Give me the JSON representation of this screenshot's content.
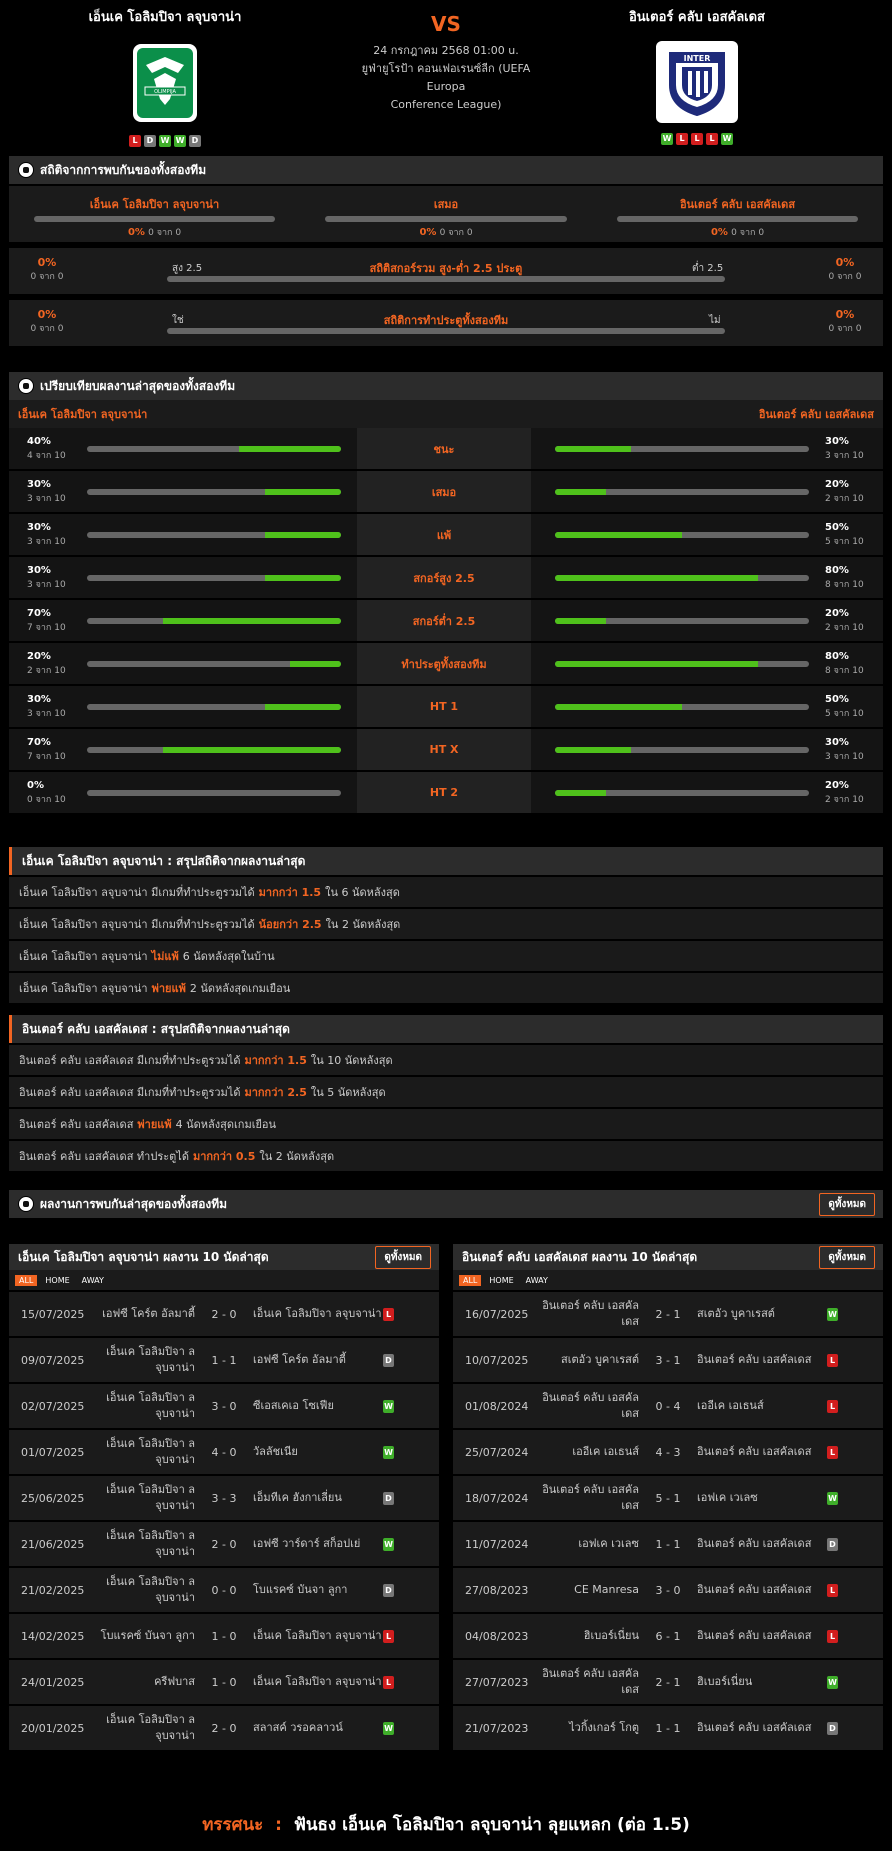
{
  "header": {
    "home_name": "เอ็นเค โอลิมปิจา ลจุบจาน่า",
    "away_name": "อินเตอร์ คลับ เอสคัลเดส",
    "vs": "VS",
    "date": "24 กรกฎาคม 2568 01:00 u.",
    "league_line1": "ยูฟ่ายูโรป้า คอนเฟอเรนซ์ลีก (UEFA Europa",
    "league_line2": "Conference League)",
    "home_form": [
      "L",
      "D",
      "W",
      "W",
      "D"
    ],
    "away_form": [
      "W",
      "L",
      "L",
      "L",
      "W"
    ],
    "home_logo_text": "OLIMPIJA",
    "away_logo_text": "INTER"
  },
  "h2h": {
    "title": "สถิติจากการพบกันของทั้งสองทีม",
    "home_label": "เอ็นเค โอลิมปิจา ลจุบจาน่า",
    "draw_label": "เสมอ",
    "away_label": "อินเตอร์ คลับ เอสคัลเดส",
    "home_pct": "0%",
    "home_of": "0 จาก 0",
    "draw_pct": "0%",
    "draw_of": "0 จาก 0",
    "away_pct": "0%",
    "away_of": "0 จาก 0",
    "ou_title": "สถิติสกอร์รวม สูง-ต่ำ 2.5 ประตู",
    "ou_left": "สูง 2.5",
    "ou_right": "ต่ำ 2.5",
    "ou_lpct": "0%",
    "ou_lof": "0 จาก 0",
    "ou_rpct": "0%",
    "ou_rof": "0 จาก 0",
    "btts_title": "สถิติการทำประตูทั้งสองทีม",
    "btts_left": "ใช่",
    "btts_right": "ไม่",
    "btts_lpct": "0%",
    "btts_lof": "0 จาก 0",
    "btts_rpct": "0%",
    "btts_rof": "0 จาก 0"
  },
  "compare": {
    "title": "เปรียบเทียบผลงานล่าสุดของทั้งสองทีม",
    "home": "เอ็นเค โอลิมปิจา ลจุบจาน่า",
    "away": "อินเตอร์ คลับ เอสคัลเดส",
    "rows": [
      {
        "label": "ชนะ",
        "hp": "40%",
        "ho": "4 จาก 10",
        "hv": 0.4,
        "ap": "30%",
        "ao": "3 จาก 10",
        "av": 0.3
      },
      {
        "label": "เสมอ",
        "hp": "30%",
        "ho": "3 จาก 10",
        "hv": 0.3,
        "ap": "20%",
        "ao": "2 จาก 10",
        "av": 0.2
      },
      {
        "label": "แพ้",
        "hp": "30%",
        "ho": "3 จาก 10",
        "hv": 0.3,
        "ap": "50%",
        "ao": "5 จาก 10",
        "av": 0.5
      },
      {
        "label": "สกอร์สูง 2.5",
        "hp": "30%",
        "ho": "3 จาก 10",
        "hv": 0.3,
        "ap": "80%",
        "ao": "8 จาก 10",
        "av": 0.8
      },
      {
        "label": "สกอร์ต่ำ 2.5",
        "hp": "70%",
        "ho": "7 จาก 10",
        "hv": 0.7,
        "ap": "20%",
        "ao": "2 จาก 10",
        "av": 0.2
      },
      {
        "label": "ทำประตูทั้งสองทีม",
        "hp": "20%",
        "ho": "2 จาก 10",
        "hv": 0.2,
        "ap": "80%",
        "ao": "8 จาก 10",
        "av": 0.8
      },
      {
        "label": "HT 1",
        "hp": "30%",
        "ho": "3 จาก 10",
        "hv": 0.3,
        "ap": "50%",
        "ao": "5 จาก 10",
        "av": 0.5
      },
      {
        "label": "HT X",
        "hp": "70%",
        "ho": "7 จาก 10",
        "hv": 0.7,
        "ap": "30%",
        "ao": "3 จาก 10",
        "av": 0.3
      },
      {
        "label": "HT 2",
        "hp": "0%",
        "ho": "0 จาก 10",
        "hv": 0.0,
        "ap": "20%",
        "ao": "2 จาก 10",
        "av": 0.2
      }
    ]
  },
  "home_summary": {
    "title": "เอ็นเค โอลิมปิจา ลจุบจาน่า : สรุปสถิติจากผลงานล่าสุด",
    "lines": [
      {
        "a": "เอ็นเค โอลิมปิจา ลจุบจาน่า มีเกมที่ทำประตูรวมได้",
        "b": "มากกว่า 1.5",
        "c": "ใน 6 นัดหลังสุด"
      },
      {
        "a": "เอ็นเค โอลิมปิจา ลจุบจาน่า มีเกมที่ทำประตูรวมได้",
        "b": "น้อยกว่า 2.5",
        "c": "ใน 2 นัดหลังสุด"
      },
      {
        "a": "เอ็นเค โอลิมปิจา ลจุบจาน่า",
        "b": "ไม่แพ้",
        "c": "6 นัดหลังสุดในบ้าน"
      },
      {
        "a": "เอ็นเค โอลิมปิจา ลจุบจาน่า",
        "b": "พ่ายแพ้",
        "c": "2 นัดหลังสุดเกมเยือน"
      }
    ]
  },
  "away_summary": {
    "title": "อินเตอร์ คลับ เอสคัลเดส : สรุปสถิติจากผลงานล่าสุด",
    "lines": [
      {
        "a": "อินเตอร์ คลับ เอสคัลเดส มีเกมที่ทำประตูรวมได้",
        "b": "มากกว่า 1.5",
        "c": "ใน 10 นัดหลังสุด"
      },
      {
        "a": "อินเตอร์ คลับ เอสคัลเดส มีเกมที่ทำประตูรวมได้",
        "b": "มากกว่า 2.5",
        "c": "ใน 5 นัดหลังสุด"
      },
      {
        "a": "อินเตอร์ คลับ เอสคัลเดส",
        "b": "พ่ายแพ้",
        "c": "4 นัดหลังสุดเกมเยือน"
      },
      {
        "a": "อินเตอร์ คลับ เอสคัลเดส ทำประตูได้",
        "b": "มากกว่า 0.5",
        "c": "ใน 2 นัดหลังสุด"
      }
    ]
  },
  "recent": {
    "title": "ผลงานการพบกันล่าสุดของทั้งสองทีม",
    "view_all": "ดูทั้งหมด"
  },
  "home_last": {
    "title": "เอ็นเค โอลิมปิจา ลจุบจาน่า ผลงาน 10 นัดล่าสุด",
    "view_all": "ดูทั้งหมด",
    "tabs": [
      "ALL",
      "HOME",
      "AWAY"
    ],
    "matches": [
      {
        "d": "15/07/2025",
        "h": "เอฟซี โคร์ต อัลมาตี้",
        "s": "2 - 0",
        "a": "เอ็นเค โอลิมปิจา ลจุบจาน่า",
        "r": "L"
      },
      {
        "d": "09/07/2025",
        "h": "เอ็นเค โอลิมปิจา ลจุบจาน่า",
        "s": "1 - 1",
        "a": "เอฟซี โคร์ต อัลมาตี้",
        "r": "D"
      },
      {
        "d": "02/07/2025",
        "h": "เอ็นเค โอลิมปิจา ลจุบจาน่า",
        "s": "3 - 0",
        "a": "ซีเอสเคเอ โซเฟีย",
        "r": "W"
      },
      {
        "d": "01/07/2025",
        "h": "เอ็นเค โอลิมปิจา ลจุบจาน่า",
        "s": "4 - 0",
        "a": "วัลลัชเนีย",
        "r": "W"
      },
      {
        "d": "25/06/2025",
        "h": "เอ็นเค โอลิมปิจา ลจุบจาน่า",
        "s": "3 - 3",
        "a": "เอ็มทีเค ฮังกาเลี่ยน",
        "r": "D"
      },
      {
        "d": "21/06/2025",
        "h": "เอ็นเค โอลิมปิจา ลจุบจาน่า",
        "s": "2 - 0",
        "a": "เอฟซี วาร์ดาร์ สก็อปเย่",
        "r": "W"
      },
      {
        "d": "21/02/2025",
        "h": "เอ็นเค โอลิมปิจา ลจุบจาน่า",
        "s": "0 - 0",
        "a": "โบแรคซ์ บันจา ลูกา",
        "r": "D"
      },
      {
        "d": "14/02/2025",
        "h": "โบแรคซ์ บันจา ลูกา",
        "s": "1 - 0",
        "a": "เอ็นเค โอลิมปิจา ลจุบจาน่า",
        "r": "L"
      },
      {
        "d": "24/01/2025",
        "h": "ครีฟบาส",
        "s": "1 - 0",
        "a": "เอ็นเค โอลิมปิจา ลจุบจาน่า",
        "r": "L"
      },
      {
        "d": "20/01/2025",
        "h": "เอ็นเค โอลิมปิจา ลจุบจาน่า",
        "s": "2 - 0",
        "a": "สลาสค์ วรอคลาวน์",
        "r": "W"
      }
    ]
  },
  "away_last": {
    "title": "อินเตอร์ คลับ เอสคัลเดส ผลงาน 10 นัดล่าสุด",
    "view_all": "ดูทั้งหมด",
    "tabs": [
      "ALL",
      "HOME",
      "AWAY"
    ],
    "matches": [
      {
        "d": "16/07/2025",
        "h": "อินเตอร์ คลับ เอสคัลเดส",
        "s": "2 - 1",
        "a": "สเตอัว บูคาเรสต์",
        "r": "W"
      },
      {
        "d": "10/07/2025",
        "h": "สเตอัว บูคาเรสต์",
        "s": "3 - 1",
        "a": "อินเตอร์ คลับ เอสคัลเดส",
        "r": "L"
      },
      {
        "d": "01/08/2024",
        "h": "อินเตอร์ คลับ เอสคัลเดส",
        "s": "0 - 4",
        "a": "เออีเค เอเธนส์",
        "r": "L"
      },
      {
        "d": "25/07/2024",
        "h": "เออีเค เอเธนส์",
        "s": "4 - 3",
        "a": "อินเตอร์ คลับ เอสคัลเดส",
        "r": "L"
      },
      {
        "d": "18/07/2024",
        "h": "อินเตอร์ คลับ เอสคัลเดส",
        "s": "5 - 1",
        "a": "เอฟเค เวเลซ",
        "r": "W"
      },
      {
        "d": "11/07/2024",
        "h": "เอฟเค เวเลซ",
        "s": "1 - 1",
        "a": "อินเตอร์ คลับ เอสคัลเดส",
        "r": "D"
      },
      {
        "d": "27/08/2023",
        "h": "CE Manresa",
        "s": "3 - 0",
        "a": "อินเตอร์ คลับ เอสคัลเดส",
        "r": "L"
      },
      {
        "d": "04/08/2023",
        "h": "ฮิเบอร์เนี่ยน",
        "s": "6 - 1",
        "a": "อินเตอร์ คลับ เอสคัลเดส",
        "r": "L"
      },
      {
        "d": "27/07/2023",
        "h": "อินเตอร์ คลับ เอสคัลเดส",
        "s": "2 - 1",
        "a": "ฮิเบอร์เนี่ยน",
        "r": "W"
      },
      {
        "d": "21/07/2023",
        "h": "ไวกิ้งเกอร์ โกตู",
        "s": "1 - 1",
        "a": "อินเตอร์ คลับ เอสคัลเดส",
        "r": "D"
      }
    ]
  },
  "footer": {
    "label": "ทรรศนะ",
    "sep": ":",
    "text": "ฟันธง เอ็นเค โอลิมปิจา ลจุบจาน่า ลุยแหลก (ต่อ 1.5)"
  },
  "colors": {
    "accent": "#f26522",
    "win": "#3fae2a",
    "loss": "#d21e1e",
    "draw": "#777777",
    "bar": "#4fc11b"
  }
}
